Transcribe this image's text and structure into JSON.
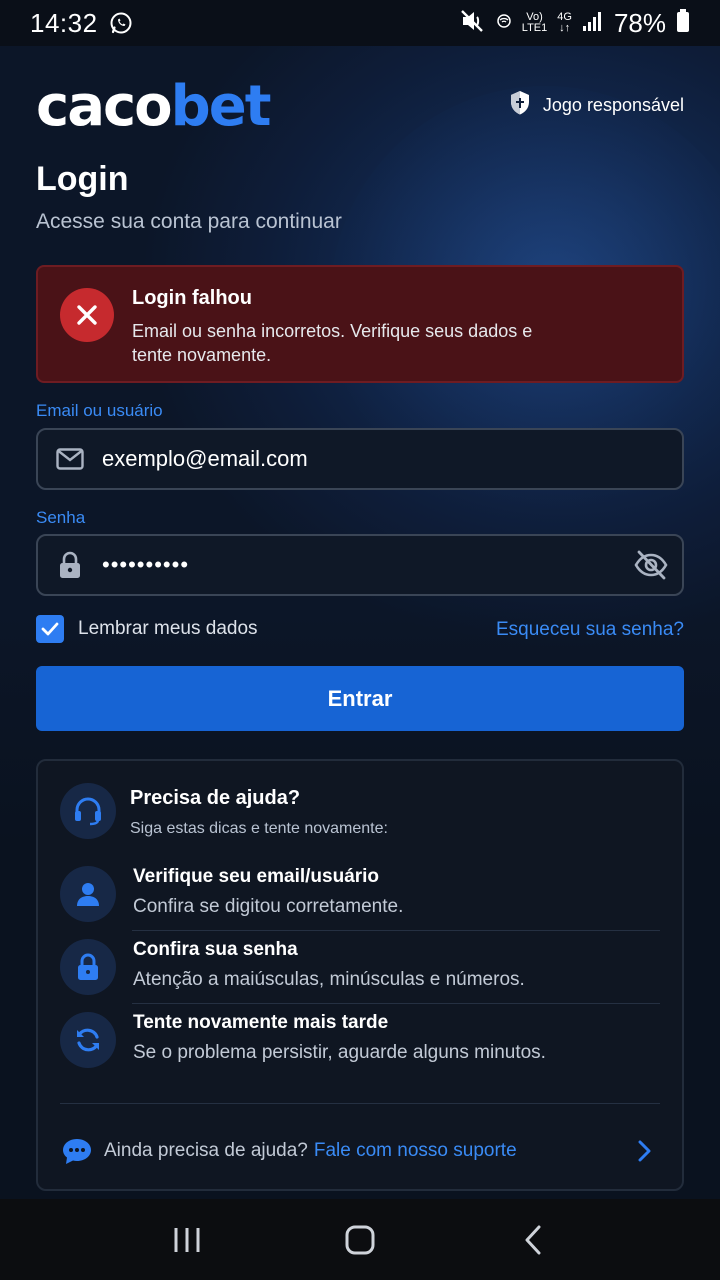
{
  "status_bar": {
    "time": "14:32",
    "battery": "78%",
    "volte_top": "Vo)",
    "volte_bottom": "LTE1",
    "net_top": "4G",
    "net_bottom": "↓↑",
    "icons": [
      "whatsapp-icon",
      "mute-icon",
      "wifi-calling-icon",
      "signal-icon",
      "battery-icon"
    ]
  },
  "header": {
    "logo_caco": "caco",
    "logo_bet": "bet",
    "responsible_label": "Jogo responsável"
  },
  "login": {
    "title": "Login",
    "subtitle": "Acesse sua conta para continuar"
  },
  "alert": {
    "title": "Login falhou",
    "message": "Email ou senha incorretos. Verifique seus dados e tente novamente."
  },
  "form": {
    "email_label": "Email ou usuário",
    "email_value": "exemplo@email.com",
    "password_label": "Senha",
    "password_value": "••••••••••",
    "remember_label": "Lembrar meus dados",
    "remember_checked": true,
    "forgot_label": "Esqueceu sua senha?",
    "submit_label": "Entrar"
  },
  "help": {
    "title": "Precisa de ajuda?",
    "subtitle": "Siga estas dicas e tente novamente:",
    "tips": [
      {
        "title": "Verifique seu email/usuário",
        "desc": "Confira se digitou corretamente.",
        "icon": "user-icon"
      },
      {
        "title": "Confira sua senha",
        "desc": "Atenção a maiúsculas, minúsculas e números.",
        "icon": "lock-icon"
      },
      {
        "title": "Tente novamente mais tarde",
        "desc": "Se o problema persistir, aguarde alguns minutos.",
        "icon": "refresh-icon"
      }
    ],
    "support_text": "Ainda precisa de ajuda?",
    "support_link": "Fale com nosso suporte"
  },
  "colors": {
    "accent": "#2e7df2",
    "button": "#1764d4",
    "error_bg": "#4a1217",
    "error_icon": "#c62a2e",
    "background": "#0c1628"
  }
}
